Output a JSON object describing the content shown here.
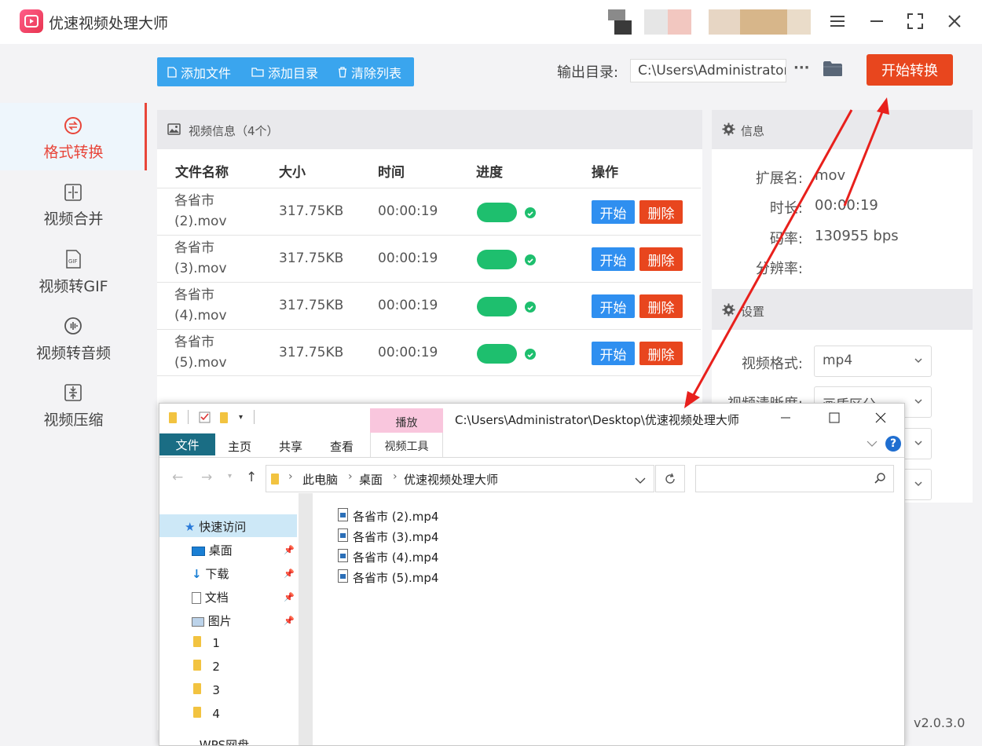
{
  "app": {
    "title": "优速视频处理大师",
    "version": "v2.0.3.0",
    "accent": "#e8461e",
    "primary": "#2f8ff0"
  },
  "window_controls": [
    "menu-icon",
    "minimize-icon",
    "fullscreen-icon",
    "close-icon"
  ],
  "sidebar": {
    "items": [
      {
        "label": "格式转换",
        "icon": "format-convert-icon",
        "active": true
      },
      {
        "label": "视频合并",
        "icon": "merge-icon",
        "active": false
      },
      {
        "label": "视频转GIF",
        "icon": "gif-icon",
        "active": false
      },
      {
        "label": "视频转音频",
        "icon": "audio-icon",
        "active": false
      },
      {
        "label": "视频压缩",
        "icon": "compress-icon",
        "active": false
      }
    ]
  },
  "toolbar": {
    "add_file": "添加文件",
    "add_dir": "添加目录",
    "clear_list": "清除列表",
    "output_label": "输出目录:",
    "output_path": "C:\\Users\\Administrator\\",
    "more": "···",
    "start_convert": "开始转换"
  },
  "video_panel": {
    "title": "视频信息（4个）",
    "columns": [
      "文件名称",
      "大小",
      "时间",
      "进度",
      "操作"
    ],
    "rows": [
      {
        "name": "各省市 (2).mov",
        "size": "317.75KB",
        "time": "00:00:19",
        "progress": 1.0
      },
      {
        "name": "各省市 (3).mov",
        "size": "317.75KB",
        "time": "00:00:19",
        "progress": 1.0
      },
      {
        "name": "各省市 (4).mov",
        "size": "317.75KB",
        "time": "00:00:19",
        "progress": 1.0
      },
      {
        "name": "各省市 (5).mov",
        "size": "317.75KB",
        "time": "00:00:19",
        "progress": 1.0
      }
    ],
    "start_label": "开始",
    "delete_label": "删除"
  },
  "info_panel": {
    "title": "信息",
    "fields": [
      {
        "key": "扩展名:",
        "value": "mov"
      },
      {
        "key": "时长:",
        "value": "00:00:19"
      },
      {
        "key": "码率:",
        "value": "130955 bps"
      },
      {
        "key": "分辨率:",
        "value": ""
      }
    ]
  },
  "settings_panel": {
    "title": "设置",
    "format_label": "视频格式:",
    "format_value": "mp4",
    "quality_label": "视频清晰度:",
    "quality_value": "画质区分"
  },
  "explorer": {
    "title": "C:\\Users\\Administrator\\Desktop\\优速视频处理大师",
    "context_tab": "播放",
    "context_group": "视频工具",
    "tabs": [
      "文件",
      "主页",
      "共享",
      "查看"
    ],
    "breadcrumb": [
      "此电脑",
      "桌面",
      "优速视频处理大师"
    ],
    "nav": [
      {
        "label": "快速访问",
        "pinned": false
      },
      {
        "label": "桌面",
        "pinned": true
      },
      {
        "label": "下载",
        "pinned": true
      },
      {
        "label": "文档",
        "pinned": true
      },
      {
        "label": "图片",
        "pinned": true
      },
      {
        "label": "1",
        "pinned": false
      },
      {
        "label": "2",
        "pinned": false
      },
      {
        "label": "3",
        "pinned": false
      },
      {
        "label": "4",
        "pinned": false
      },
      {
        "label": "WPS网盘",
        "pinned": false
      }
    ],
    "files": [
      "各省市 (2).mp4",
      "各省市 (3).mp4",
      "各省市 (4).mp4",
      "各省市 (5).mp4"
    ]
  }
}
